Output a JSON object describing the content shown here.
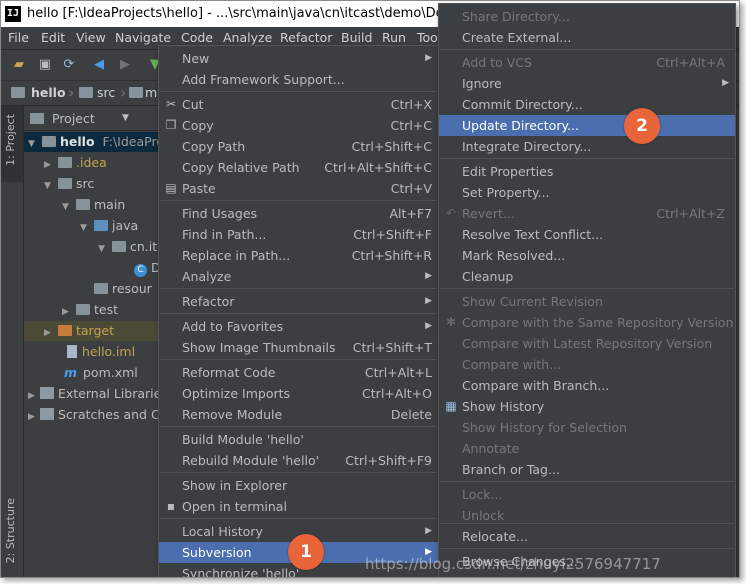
{
  "window": {
    "logo": "IJ",
    "title": "hello [F:\\IdeaProjects\\hello] - ...\\src\\main\\java\\cn\\itcast\\demo\\Demo.jav"
  },
  "menubar": [
    "File",
    "Edit",
    "View",
    "Navigate",
    "Code",
    "Analyze",
    "Refactor",
    "Build",
    "Run",
    "Too"
  ],
  "breadcrumbs": [
    "hello",
    "src",
    "ma"
  ],
  "tool_stripe": {
    "project_tab": "1: Project",
    "structure_tab": "2: Structure"
  },
  "project_pane": {
    "header": "Project",
    "tree": [
      {
        "label": "hello",
        "path": "F:\\IdeaPro"
      },
      {
        "label": ".idea"
      },
      {
        "label": "src"
      },
      {
        "label": "main"
      },
      {
        "label": "java"
      },
      {
        "label": "cn.it"
      },
      {
        "label": "D"
      },
      {
        "label": "resour"
      },
      {
        "label": "test"
      },
      {
        "label": "target"
      },
      {
        "label": "hello.iml"
      },
      {
        "label": "pom.xml"
      },
      {
        "label": "External Librarie"
      },
      {
        "label": "Scratches and C"
      }
    ]
  },
  "context_menu": {
    "items": [
      {
        "label": "New",
        "shortcut": ""
      },
      {
        "label": "Add Framework Support...",
        "shortcut": ""
      },
      {
        "label": "Cut",
        "shortcut": "Ctrl+X",
        "icon": "scissors-icon"
      },
      {
        "label": "Copy",
        "shortcut": "Ctrl+C",
        "icon": "copy-icon"
      },
      {
        "label": "Copy Path",
        "shortcut": "Ctrl+Shift+C"
      },
      {
        "label": "Copy Relative Path",
        "shortcut": "Ctrl+Alt+Shift+C"
      },
      {
        "label": "Paste",
        "shortcut": "Ctrl+V",
        "icon": "paste-icon"
      },
      {
        "label": "Find Usages",
        "shortcut": "Alt+F7"
      },
      {
        "label": "Find in Path...",
        "shortcut": "Ctrl+Shift+F"
      },
      {
        "label": "Replace in Path...",
        "shortcut": "Ctrl+Shift+R"
      },
      {
        "label": "Analyze",
        "shortcut": ""
      },
      {
        "label": "Refactor",
        "shortcut": ""
      },
      {
        "label": "Add to Favorites",
        "shortcut": ""
      },
      {
        "label": "Show Image Thumbnails",
        "shortcut": "Ctrl+Shift+T"
      },
      {
        "label": "Reformat Code",
        "shortcut": "Ctrl+Alt+L"
      },
      {
        "label": "Optimize Imports",
        "shortcut": "Ctrl+Alt+O"
      },
      {
        "label": "Remove Module",
        "shortcut": "Delete"
      },
      {
        "label": "Build Module 'hello'",
        "shortcut": ""
      },
      {
        "label": "Rebuild Module 'hello'",
        "shortcut": "Ctrl+Shift+F9"
      },
      {
        "label": "Show in Explorer",
        "shortcut": ""
      },
      {
        "label": "Open in terminal",
        "shortcut": "",
        "icon": "terminal-icon"
      },
      {
        "label": "Local History",
        "shortcut": ""
      },
      {
        "label": "Subversion",
        "shortcut": ""
      },
      {
        "label": "Synchronize 'hello'",
        "shortcut": ""
      }
    ]
  },
  "subversion_menu": {
    "items": [
      {
        "label": "Share Directory...",
        "shortcut": ""
      },
      {
        "label": "Create External...",
        "shortcut": ""
      },
      {
        "label": "Add to VCS",
        "shortcut": "Ctrl+Alt+A"
      },
      {
        "label": "Ignore",
        "shortcut": ""
      },
      {
        "label": "Commit Directory...",
        "shortcut": ""
      },
      {
        "label": "Update Directory...",
        "shortcut": ""
      },
      {
        "label": "Integrate Directory...",
        "shortcut": ""
      },
      {
        "label": "Edit Properties",
        "shortcut": ""
      },
      {
        "label": "Set Property...",
        "shortcut": ""
      },
      {
        "label": "Revert...",
        "shortcut": "Ctrl+Alt+Z",
        "icon": "revert-icon"
      },
      {
        "label": "Resolve Text Conflict...",
        "shortcut": ""
      },
      {
        "label": "Mark Resolved...",
        "shortcut": ""
      },
      {
        "label": "Cleanup",
        "shortcut": ""
      },
      {
        "label": "Show Current Revision",
        "shortcut": ""
      },
      {
        "label": "Compare with the Same Repository Version",
        "shortcut": "",
        "icon": "compare-icon"
      },
      {
        "label": "Compare with Latest Repository Version",
        "shortcut": ""
      },
      {
        "label": "Compare with...",
        "shortcut": ""
      },
      {
        "label": "Compare with Branch...",
        "shortcut": ""
      },
      {
        "label": "Show History",
        "shortcut": "",
        "icon": "history-icon"
      },
      {
        "label": "Show History for Selection",
        "shortcut": ""
      },
      {
        "label": "Annotate",
        "shortcut": ""
      },
      {
        "label": "Branch or Tag...",
        "shortcut": ""
      },
      {
        "label": "Lock...",
        "shortcut": ""
      },
      {
        "label": "Unlock",
        "shortcut": ""
      },
      {
        "label": "Relocate...",
        "shortcut": ""
      },
      {
        "label": "Browse Changes...",
        "shortcut": ""
      }
    ]
  },
  "annotations": {
    "step1": "1",
    "step2": "2"
  },
  "watermark": "https://blog.csdn.net/zhuyi2576947717",
  "colors": {
    "menu_bg": "#3c3f41",
    "selection": "#4b6eaf",
    "badge": "#e8653a",
    "tree_selected": "#0d293e"
  }
}
